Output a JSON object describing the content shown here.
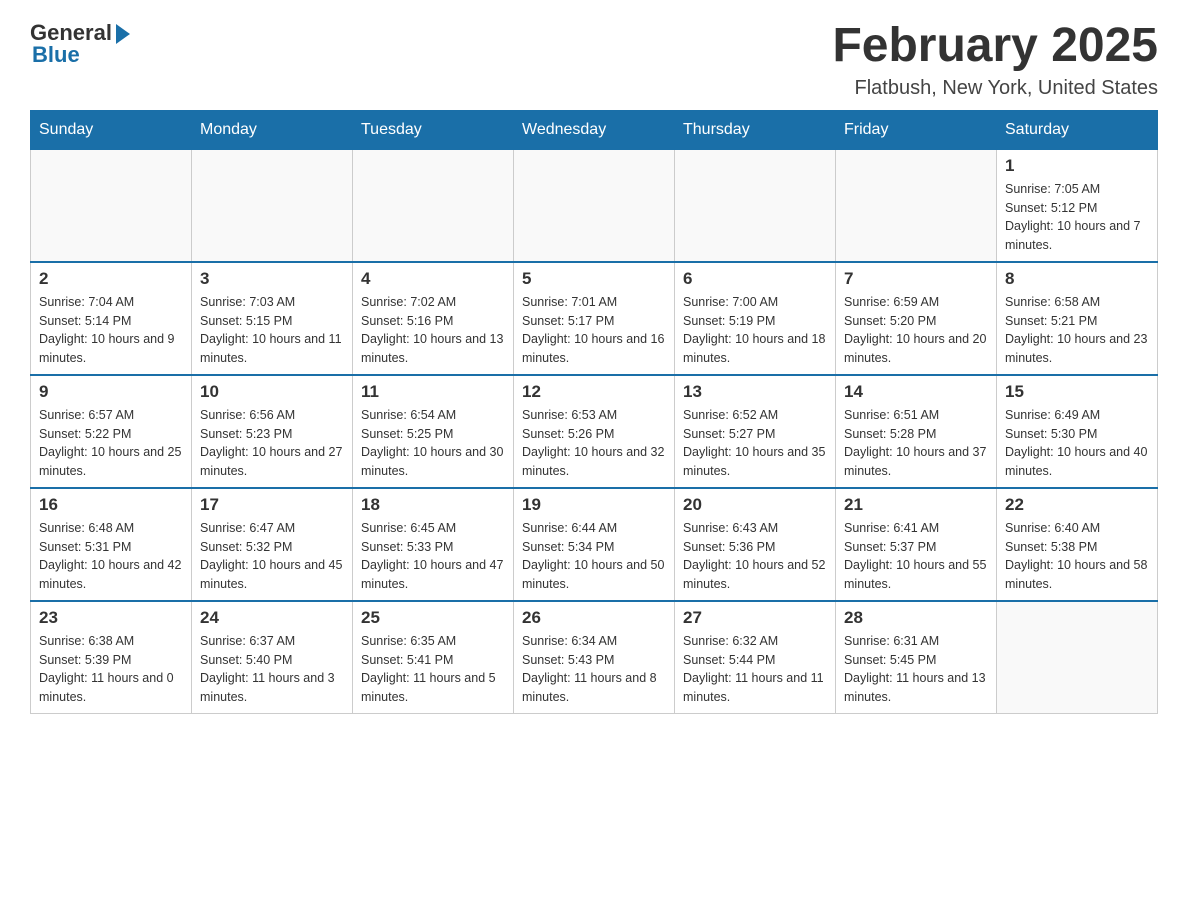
{
  "header": {
    "logo_general": "General",
    "logo_blue": "Blue",
    "month_title": "February 2025",
    "location": "Flatbush, New York, United States"
  },
  "days_of_week": [
    "Sunday",
    "Monday",
    "Tuesday",
    "Wednesday",
    "Thursday",
    "Friday",
    "Saturday"
  ],
  "weeks": [
    [
      {
        "day": "",
        "info": ""
      },
      {
        "day": "",
        "info": ""
      },
      {
        "day": "",
        "info": ""
      },
      {
        "day": "",
        "info": ""
      },
      {
        "day": "",
        "info": ""
      },
      {
        "day": "",
        "info": ""
      },
      {
        "day": "1",
        "info": "Sunrise: 7:05 AM\nSunset: 5:12 PM\nDaylight: 10 hours and 7 minutes."
      }
    ],
    [
      {
        "day": "2",
        "info": "Sunrise: 7:04 AM\nSunset: 5:14 PM\nDaylight: 10 hours and 9 minutes."
      },
      {
        "day": "3",
        "info": "Sunrise: 7:03 AM\nSunset: 5:15 PM\nDaylight: 10 hours and 11 minutes."
      },
      {
        "day": "4",
        "info": "Sunrise: 7:02 AM\nSunset: 5:16 PM\nDaylight: 10 hours and 13 minutes."
      },
      {
        "day": "5",
        "info": "Sunrise: 7:01 AM\nSunset: 5:17 PM\nDaylight: 10 hours and 16 minutes."
      },
      {
        "day": "6",
        "info": "Sunrise: 7:00 AM\nSunset: 5:19 PM\nDaylight: 10 hours and 18 minutes."
      },
      {
        "day": "7",
        "info": "Sunrise: 6:59 AM\nSunset: 5:20 PM\nDaylight: 10 hours and 20 minutes."
      },
      {
        "day": "8",
        "info": "Sunrise: 6:58 AM\nSunset: 5:21 PM\nDaylight: 10 hours and 23 minutes."
      }
    ],
    [
      {
        "day": "9",
        "info": "Sunrise: 6:57 AM\nSunset: 5:22 PM\nDaylight: 10 hours and 25 minutes."
      },
      {
        "day": "10",
        "info": "Sunrise: 6:56 AM\nSunset: 5:23 PM\nDaylight: 10 hours and 27 minutes."
      },
      {
        "day": "11",
        "info": "Sunrise: 6:54 AM\nSunset: 5:25 PM\nDaylight: 10 hours and 30 minutes."
      },
      {
        "day": "12",
        "info": "Sunrise: 6:53 AM\nSunset: 5:26 PM\nDaylight: 10 hours and 32 minutes."
      },
      {
        "day": "13",
        "info": "Sunrise: 6:52 AM\nSunset: 5:27 PM\nDaylight: 10 hours and 35 minutes."
      },
      {
        "day": "14",
        "info": "Sunrise: 6:51 AM\nSunset: 5:28 PM\nDaylight: 10 hours and 37 minutes."
      },
      {
        "day": "15",
        "info": "Sunrise: 6:49 AM\nSunset: 5:30 PM\nDaylight: 10 hours and 40 minutes."
      }
    ],
    [
      {
        "day": "16",
        "info": "Sunrise: 6:48 AM\nSunset: 5:31 PM\nDaylight: 10 hours and 42 minutes."
      },
      {
        "day": "17",
        "info": "Sunrise: 6:47 AM\nSunset: 5:32 PM\nDaylight: 10 hours and 45 minutes."
      },
      {
        "day": "18",
        "info": "Sunrise: 6:45 AM\nSunset: 5:33 PM\nDaylight: 10 hours and 47 minutes."
      },
      {
        "day": "19",
        "info": "Sunrise: 6:44 AM\nSunset: 5:34 PM\nDaylight: 10 hours and 50 minutes."
      },
      {
        "day": "20",
        "info": "Sunrise: 6:43 AM\nSunset: 5:36 PM\nDaylight: 10 hours and 52 minutes."
      },
      {
        "day": "21",
        "info": "Sunrise: 6:41 AM\nSunset: 5:37 PM\nDaylight: 10 hours and 55 minutes."
      },
      {
        "day": "22",
        "info": "Sunrise: 6:40 AM\nSunset: 5:38 PM\nDaylight: 10 hours and 58 minutes."
      }
    ],
    [
      {
        "day": "23",
        "info": "Sunrise: 6:38 AM\nSunset: 5:39 PM\nDaylight: 11 hours and 0 minutes."
      },
      {
        "day": "24",
        "info": "Sunrise: 6:37 AM\nSunset: 5:40 PM\nDaylight: 11 hours and 3 minutes."
      },
      {
        "day": "25",
        "info": "Sunrise: 6:35 AM\nSunset: 5:41 PM\nDaylight: 11 hours and 5 minutes."
      },
      {
        "day": "26",
        "info": "Sunrise: 6:34 AM\nSunset: 5:43 PM\nDaylight: 11 hours and 8 minutes."
      },
      {
        "day": "27",
        "info": "Sunrise: 6:32 AM\nSunset: 5:44 PM\nDaylight: 11 hours and 11 minutes."
      },
      {
        "day": "28",
        "info": "Sunrise: 6:31 AM\nSunset: 5:45 PM\nDaylight: 11 hours and 13 minutes."
      },
      {
        "day": "",
        "info": ""
      }
    ]
  ]
}
